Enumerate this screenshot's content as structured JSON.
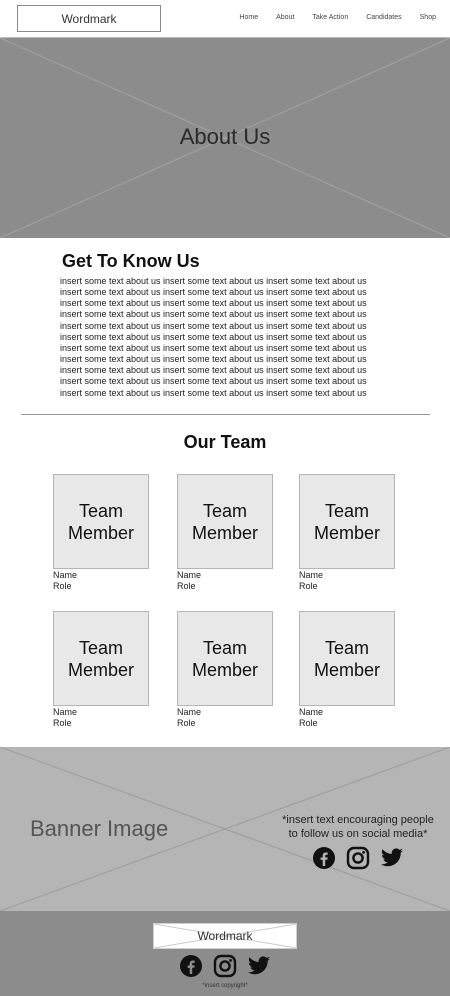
{
  "header": {
    "wordmark": "Wordmark",
    "nav": [
      {
        "label": "Home"
      },
      {
        "label": "About"
      },
      {
        "label": "Take Action"
      },
      {
        "label": "Candidates"
      },
      {
        "label": "Shop"
      }
    ]
  },
  "hero": {
    "title": "About Us"
  },
  "about": {
    "heading": "Get To Know Us",
    "lines": [
      "insert some text about us insert some text about us insert some text about us",
      "insert some text about us insert some text about us insert some text about us",
      "insert some text about us insert some text about us insert some text about us",
      "insert some text about us insert some text about us insert some text about us",
      "insert some text about us insert some text about us insert some text about us",
      "insert some text about us insert some text about us insert some text about us",
      "insert some text about us insert some text about us insert some text about us",
      "insert some text about us insert some text about us insert some text about us",
      "insert some text about us insert some text about us insert some text about us",
      "insert some text about us insert some text about us insert some text about us",
      "insert some text about us insert some text about us insert some text about us"
    ]
  },
  "team": {
    "heading": "Our Team",
    "members": [
      {
        "card_line1": "Team",
        "card_line2": "Member",
        "name": "Name",
        "role": "Role"
      },
      {
        "card_line1": "Team",
        "card_line2": "Member",
        "name": "Name",
        "role": "Role"
      },
      {
        "card_line1": "Team",
        "card_line2": "Member",
        "name": "Name",
        "role": "Role"
      },
      {
        "card_line1": "Team",
        "card_line2": "Member",
        "name": "Name",
        "role": "Role"
      },
      {
        "card_line1": "Team",
        "card_line2": "Member",
        "name": "Name",
        "role": "Role"
      },
      {
        "card_line1": "Team",
        "card_line2": "Member",
        "name": "Name",
        "role": "Role"
      }
    ]
  },
  "banner": {
    "title": "Banner Image",
    "social_text_line1": "*insert text encouraging people",
    "social_text_line2": "to follow us on social media*",
    "icons": [
      "facebook-icon",
      "instagram-icon",
      "twitter-icon"
    ]
  },
  "footer": {
    "wordmark": "Wordmark",
    "icons": [
      "facebook-icon",
      "instagram-icon",
      "twitter-icon"
    ],
    "copyright": "*insert copyright*"
  },
  "colors": {
    "hero_bg": "#8c8c8c",
    "banner_bg": "#b5b5b5",
    "footer_bg": "#8c8c8c",
    "card_bg": "#e8e8e8"
  }
}
